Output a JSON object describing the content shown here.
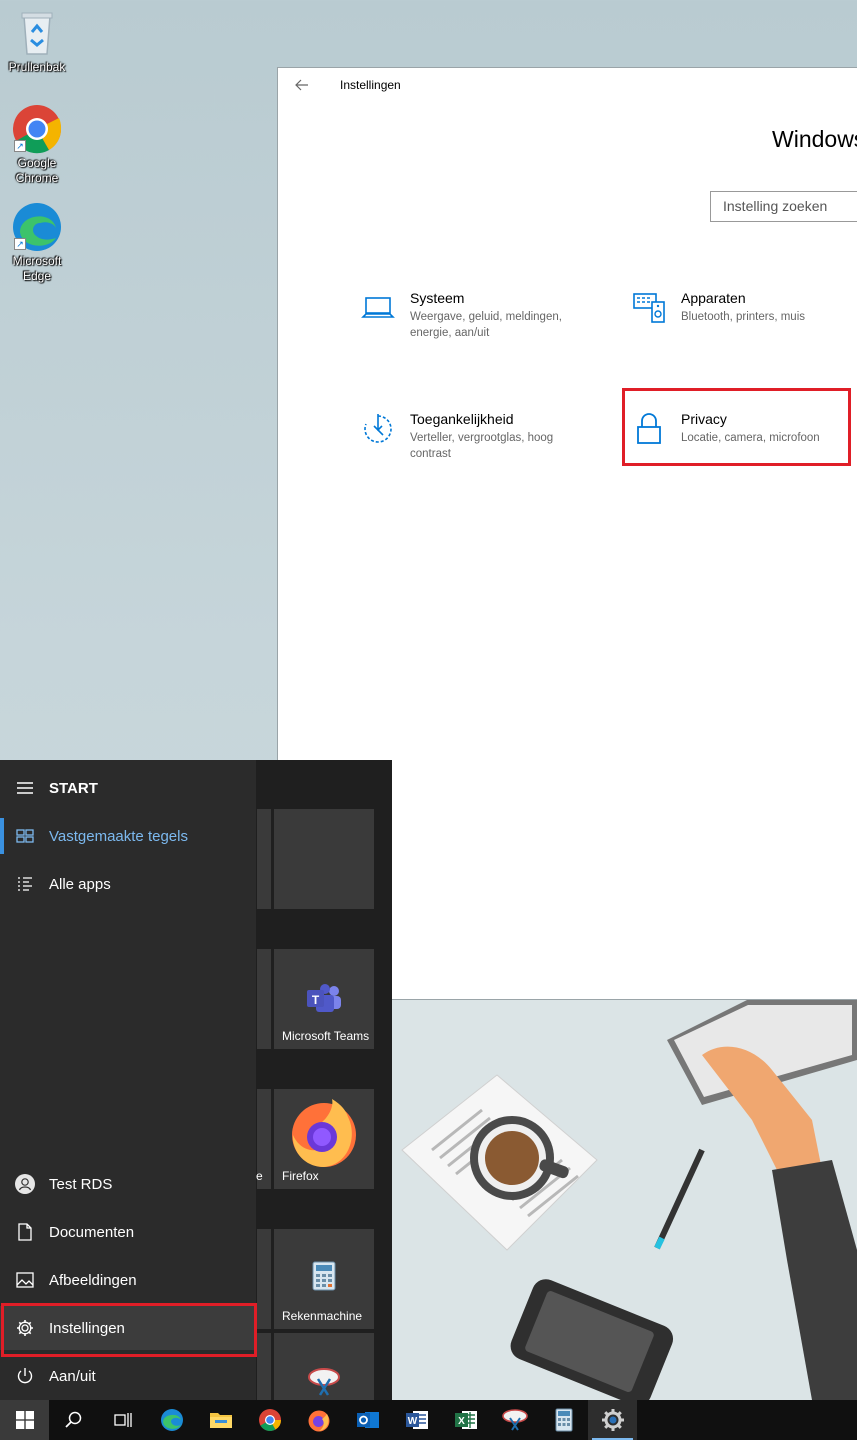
{
  "desktop": {
    "icons": [
      {
        "label": "Prullenbak",
        "icon": "recycle-bin-icon"
      },
      {
        "label": "Google Chrome",
        "icon": "chrome-icon"
      },
      {
        "label": "Microsoft Edge",
        "icon": "edge-icon"
      }
    ]
  },
  "settings": {
    "title": "Instellingen",
    "heading": "Windows",
    "search_placeholder": "Instelling zoeken",
    "categories": [
      {
        "name": "Systeem",
        "desc": "Weergave, geluid, meldingen, energie, aan/uit",
        "icon": "laptop-icon"
      },
      {
        "name": "Apparaten",
        "desc": "Bluetooth, printers, muis",
        "icon": "devices-icon"
      },
      {
        "name": "Toegankelijkheid",
        "desc": "Verteller, vergrootglas, hoog contrast",
        "icon": "ease-of-access-icon"
      },
      {
        "name": "Privacy",
        "desc": "Locatie, camera, microfoon",
        "icon": "lock-icon"
      }
    ],
    "accent": "#0078d7",
    "highlight_color": "#e01e27"
  },
  "start_menu": {
    "title": "START",
    "items": [
      {
        "label": "Vastgemaakte tegels",
        "icon": "tiles-icon"
      },
      {
        "label": "Alle apps",
        "icon": "list-icon"
      },
      {
        "label": "Test RDS",
        "icon": "user-avatar-icon"
      },
      {
        "label": "Documenten",
        "icon": "document-icon"
      },
      {
        "label": "Afbeeldingen",
        "icon": "pictures-icon"
      },
      {
        "label": "Instellingen",
        "icon": "gear-icon"
      },
      {
        "label": "Aan/uit",
        "icon": "power-icon"
      }
    ],
    "tiles": [
      {
        "label": "Microsoft Teams",
        "icon": "teams-icon"
      },
      {
        "label": "Firefox",
        "icon": "firefox-icon"
      },
      {
        "label": "Rekenmachine",
        "icon": "calculator-icon"
      }
    ],
    "partial_tile_label": "e"
  },
  "taskbar": {
    "buttons": [
      "start-icon",
      "search-icon",
      "task-view-icon",
      "edge-icon",
      "file-explorer-icon",
      "chrome-icon",
      "firefox-icon",
      "outlook-icon",
      "word-icon",
      "excel-icon",
      "snipping-tool-icon",
      "calculator-icon",
      "settings-icon"
    ]
  }
}
